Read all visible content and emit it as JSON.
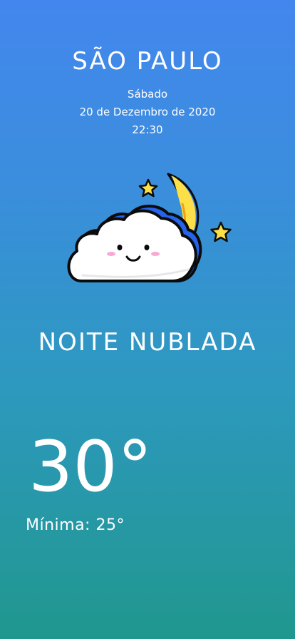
{
  "location": {
    "city": "SÃO PAULO"
  },
  "datetime": {
    "weekday": "Sábado",
    "date": "20 de Dezembro de 2020",
    "time": "22:30"
  },
  "weather": {
    "icon": "cloudy-night-icon",
    "condition": "NOITE NUBLADA",
    "temperature": "30°",
    "min_label": "Mínima: 25°"
  },
  "colors": {
    "gradient_top": "#4387ee",
    "gradient_bottom": "#20978e",
    "moon": "#fde047",
    "cloud": "#ffffff",
    "outline": "#0b0b0b"
  }
}
